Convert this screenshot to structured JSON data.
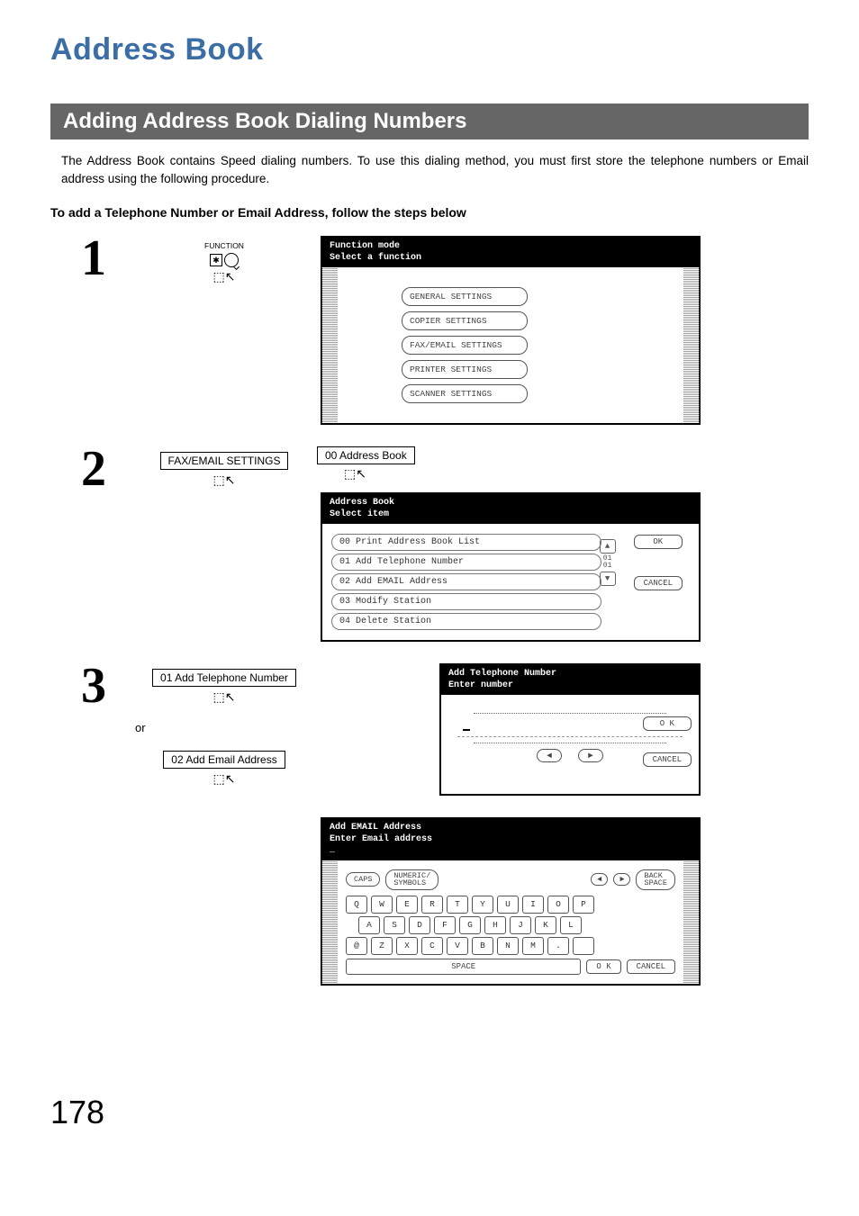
{
  "page_title": "Address Book",
  "section_title": "Adding Address Book Dialing Numbers",
  "intro_text": "The Address Book contains Speed dialing numbers. To use this dialing method, you must first store the telephone numbers or Email address using the following procedure.",
  "sub_heading": "To add a Telephone Number or Email Address, follow the steps below",
  "steps": {
    "s1": {
      "num": "1",
      "function_label": "FUNCTION"
    },
    "s2": {
      "num": "2",
      "button_a": "FAX/EMAIL SETTINGS",
      "button_b": "00 Address Book"
    },
    "s3": {
      "num": "3",
      "button_a": "01 Add Telephone Number",
      "or": "or",
      "button_b": "02 Add Email Address"
    }
  },
  "screen1": {
    "title_line1": "Function mode",
    "title_line2": "Select a function",
    "buttons": [
      "GENERAL SETTINGS",
      "COPIER SETTINGS",
      "FAX/EMAIL SETTINGS",
      "PRINTER SETTINGS",
      "SCANNER SETTINGS"
    ]
  },
  "screen2": {
    "title_line1": "Address Book",
    "title_line2": "Select item",
    "items": [
      "00  Print Address Book List",
      "01  Add Telephone Number",
      "02  Add EMAIL Address",
      "03  Modify Station",
      "04  Delete Station"
    ],
    "page_ind": "01\n01",
    "ok": "OK",
    "cancel": "CANCEL"
  },
  "screen3": {
    "title_line1": "Add Telephone Number",
    "title_line2": "Enter number",
    "ok": "O K",
    "cancel": "CANCEL"
  },
  "screen4": {
    "title_line1": "Add EMAIL Address",
    "title_line2": "Enter Email address",
    "caps": "CAPS",
    "numsym": "NUMERIC/\nSYMBOLS",
    "back": "BACK\nSPACE",
    "row1": [
      "Q",
      "W",
      "E",
      "R",
      "T",
      "Y",
      "U",
      "I",
      "O",
      "P"
    ],
    "row2": [
      "A",
      "S",
      "D",
      "F",
      "G",
      "H",
      "J",
      "K",
      "L"
    ],
    "row3": [
      "@",
      "Z",
      "X",
      "C",
      "V",
      "B",
      "N",
      "M",
      ".",
      " "
    ],
    "space": "SPACE",
    "ok": "O K",
    "cancel": "CANCEL"
  },
  "page_number": "178"
}
